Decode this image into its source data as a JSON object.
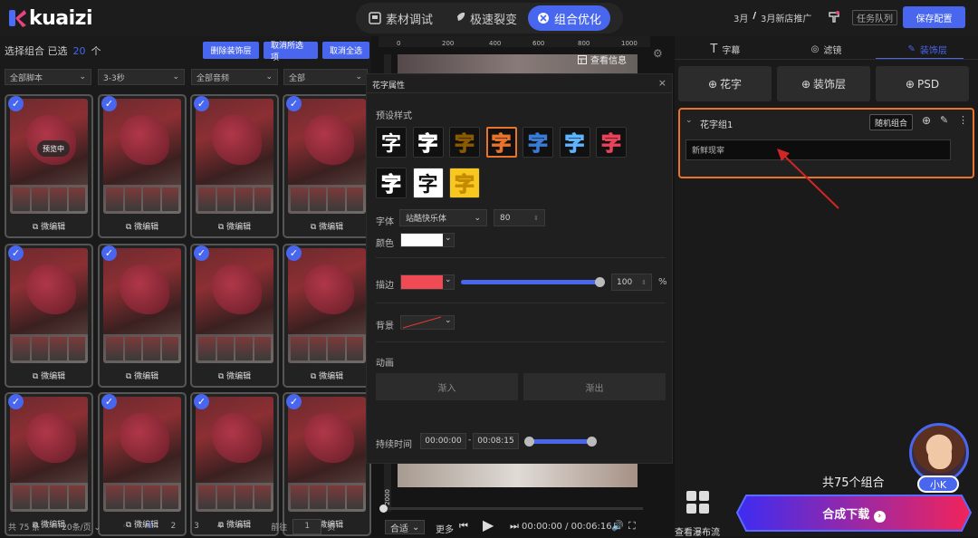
{
  "brand": {
    "name": "kuaizi"
  },
  "top_tabs": [
    {
      "label": "素材调试",
      "icon": "film-icon"
    },
    {
      "label": "极速裂变",
      "icon": "rocket-icon"
    },
    {
      "label": "组合优化",
      "icon": "hub-icon",
      "active": true
    }
  ],
  "topbar_right": {
    "month": "3月",
    "sep": "/",
    "campaign": "3月新店推广",
    "task_queue": "任务队列",
    "save": "保存配置"
  },
  "left": {
    "select_label": "选择组合 已选",
    "select_count": "20",
    "select_unit": "个",
    "buttons": [
      "删除装饰层",
      "取消所选项",
      "取消全选"
    ],
    "filters": [
      "全部脚本",
      "3-3秒",
      "全部音频",
      "全部"
    ],
    "cards": [
      {
        "checked": true,
        "edit": "微编辑",
        "preview": "预览中"
      },
      {
        "checked": true,
        "edit": "微编辑"
      },
      {
        "checked": true,
        "edit": "微编辑"
      },
      {
        "checked": true,
        "edit": "微编辑"
      },
      {
        "checked": true,
        "edit": "微编辑"
      },
      {
        "checked": true,
        "edit": "微编辑"
      },
      {
        "checked": true,
        "edit": "微编辑"
      },
      {
        "checked": true,
        "edit": "微编辑"
      },
      {
        "checked": true,
        "edit": "微编辑"
      },
      {
        "checked": true,
        "edit": "微编辑"
      },
      {
        "checked": true,
        "edit": "微编辑"
      },
      {
        "checked": true,
        "edit": "微编辑"
      }
    ],
    "pager": {
      "total": "共 75 条",
      "per_page": "20条/页",
      "pages": [
        "1",
        "2",
        "3",
        "4"
      ],
      "goto": "前往",
      "goto_val": "1",
      "page_suffix": "页",
      "prev": "‹",
      "next": "›"
    }
  },
  "middle": {
    "ruler": [
      "0",
      "200",
      "400",
      "600",
      "800",
      "1000"
    ],
    "vruler": "2000",
    "view_info": "查看信息",
    "dialog": {
      "title": "花字属性",
      "preset_label": "预设样式",
      "glyph": "字",
      "font_label": "字体",
      "font_value": "站酷快乐体",
      "size_value": "80",
      "color_label": "颜色",
      "stroke_label": "描边",
      "stroke_value": "100",
      "stroke_unit": "%",
      "stroke_level": 1.0,
      "bg_label": "背景",
      "anim_label": "动画",
      "anim_in": "渐入",
      "anim_out": "渐出",
      "duration_label": "持续时间",
      "start": "00:00:00",
      "dash": "-",
      "end": "00:08:15"
    },
    "playbar": {
      "fit": "合适",
      "more": "更多",
      "time": "00:00:00 / 00:06:16"
    }
  },
  "right": {
    "tabs": [
      {
        "label": "字幕",
        "icon": "text-icon"
      },
      {
        "label": "滤镜",
        "icon": "filter-icon"
      },
      {
        "label": "装饰层",
        "icon": "brush-icon",
        "active": true
      }
    ],
    "adds": [
      "花字",
      "装饰层",
      "PSD"
    ],
    "group": {
      "title": "花字组1",
      "random": "随机组合",
      "input_value": "新鲜现宰"
    },
    "total": "共75个组合",
    "waterfall": "查看瀑布流",
    "compose": "合成下载",
    "assistant": "小K"
  },
  "colors": {
    "accent": "#4866ee",
    "highlight": "#e8742c",
    "stroke_color": "#f04b55"
  }
}
